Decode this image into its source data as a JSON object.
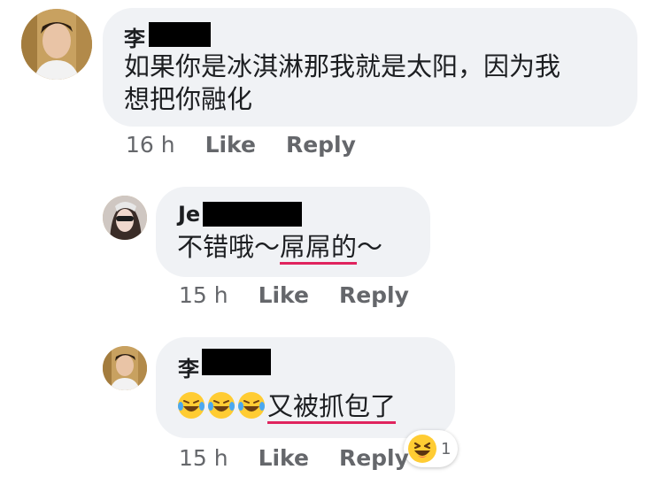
{
  "comments": [
    {
      "author_visible": "李",
      "text": "如果你是冰淇淋那我就是太阳，因为我",
      "text_line2": "想把你融化",
      "time": "16 h",
      "like_label": "Like",
      "reply_label": "Reply"
    },
    {
      "author_visible": "Je",
      "text_plain": "不错哦～",
      "text_underlined": "屌屌的",
      "text_tail": "～",
      "time": "15 h",
      "like_label": "Like",
      "reply_label": "Reply"
    },
    {
      "author_visible": "李",
      "emoji_icon": "laughing-tears-emoji-icon",
      "text_underlined": "又被抓包了",
      "time": "15 h",
      "like_label": "Like",
      "reply_label": "Reply",
      "reaction_icon": "haha-reaction-icon",
      "reaction_count": "1"
    }
  ],
  "colors": {
    "bubble": "#f0f2f5",
    "meta": "#65676b",
    "underline": "#e0245e"
  }
}
